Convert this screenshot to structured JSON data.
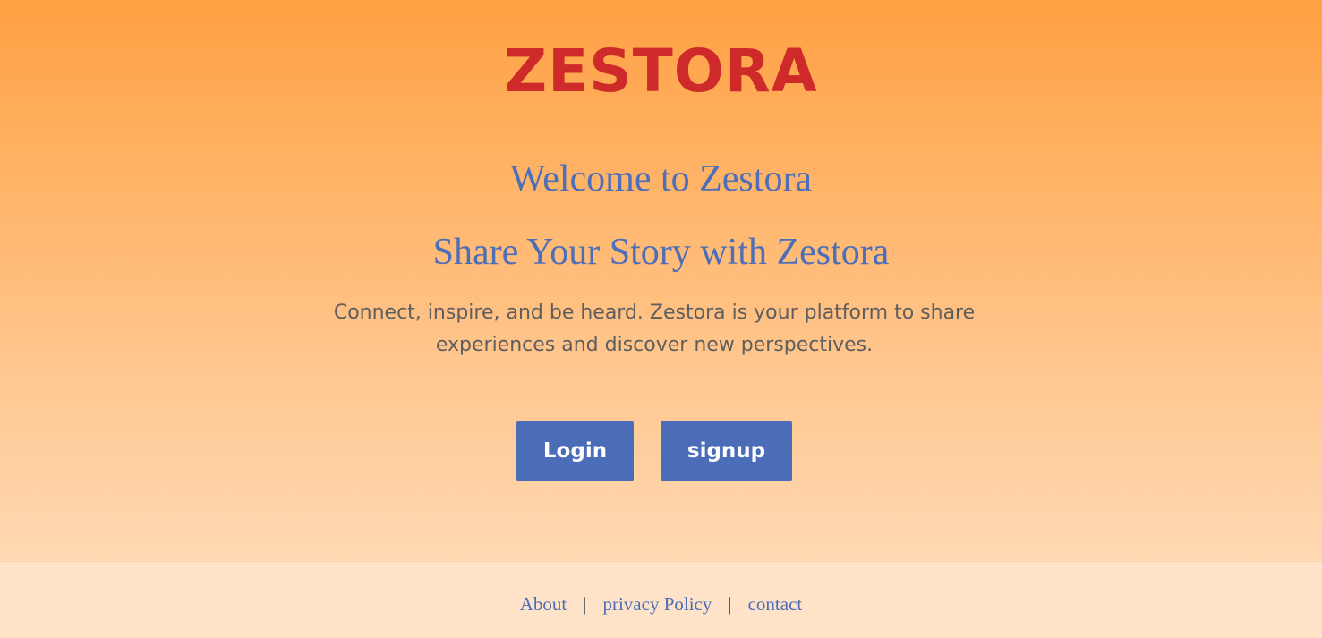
{
  "header": {
    "brand": "ZESTORA"
  },
  "hero": {
    "welcome": "Welcome to Zestora",
    "tagline": "Share Your Story with Zestora",
    "description": "Connect, inspire, and be heard. Zestora is your platform to share experiences and discover new perspectives."
  },
  "actions": {
    "login_label": "Login",
    "signup_label": "signup"
  },
  "footer": {
    "links": [
      "About",
      "privacy Policy",
      "contact"
    ],
    "separator": "|"
  },
  "colors": {
    "brand_red": "#cf2a2a",
    "accent_blue": "#4b6cb7",
    "gradient_top": "#ffa043",
    "gradient_bottom": "#ffd9b3",
    "footer_bg": "#ffe3c9"
  }
}
